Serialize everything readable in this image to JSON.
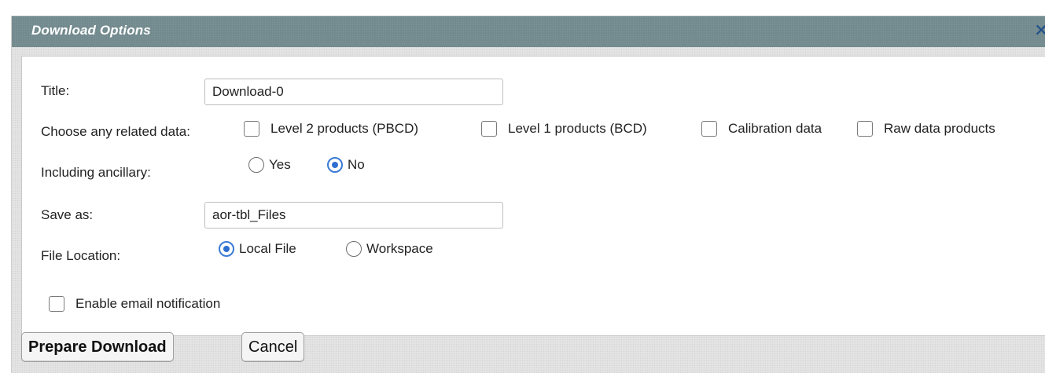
{
  "dialog": {
    "title": "Download Options",
    "close_icon": "close-icon"
  },
  "form": {
    "title_label": "Title:",
    "title_value": "Download-0",
    "related_label": "Choose any related data:",
    "related_options": [
      {
        "label": "Level 2 products (PBCD)",
        "checked": false
      },
      {
        "label": "Level 1 products (BCD)",
        "checked": false
      },
      {
        "label": "Calibration data",
        "checked": false
      },
      {
        "label": "Raw data products",
        "checked": false
      }
    ],
    "ancillary_label": "Including ancillary:",
    "ancillary_options": [
      {
        "label": "Yes",
        "selected": false
      },
      {
        "label": "No",
        "selected": true
      }
    ],
    "save_as_label": "Save as:",
    "save_as_value": "aor-tbl_Files",
    "location_label": "File Location:",
    "location_options": [
      {
        "label": "Local File",
        "selected": true
      },
      {
        "label": "Workspace",
        "selected": false
      }
    ],
    "email_label": "Enable email notification",
    "email_checked": false
  },
  "buttons": {
    "prepare": "Prepare Download",
    "cancel": "Cancel"
  },
  "colors": {
    "titlebar": "#728a8e",
    "accent": "#2f6fd0"
  }
}
